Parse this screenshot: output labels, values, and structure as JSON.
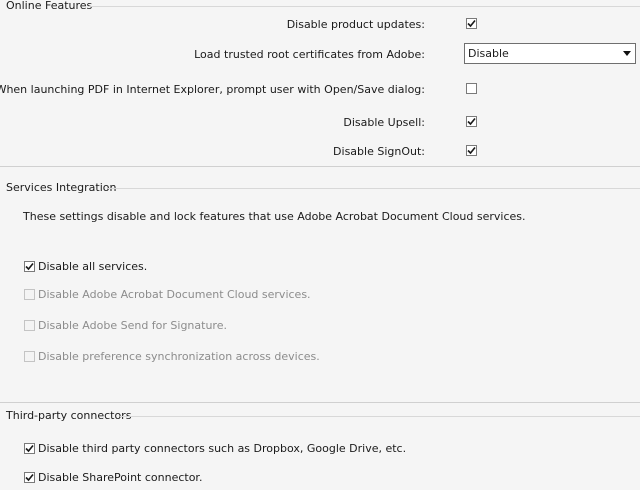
{
  "online_features": {
    "title": "Online Features",
    "disable_updates": {
      "label": "Disable product updates:",
      "checked": true
    },
    "root_certs": {
      "label": "Load trusted root certificates from Adobe:",
      "value": "Disable"
    },
    "ie_prompt": {
      "label": "When launching PDF in Internet Explorer, prompt user with Open/Save dialog:",
      "checked": false
    },
    "disable_upsell": {
      "label": "Disable Upsell:",
      "checked": true
    },
    "disable_signout": {
      "label": "Disable SignOut:",
      "checked": true
    }
  },
  "services_integration": {
    "title": "Services Integration",
    "description": "These settings disable and lock features that use Adobe Acrobat Document Cloud services.",
    "options": [
      {
        "label": "Disable all services.",
        "checked": true,
        "enabled": true
      },
      {
        "label": "Disable Adobe Acrobat Document Cloud services.",
        "checked": false,
        "enabled": false
      },
      {
        "label": "Disable Adobe Send for Signature.",
        "checked": false,
        "enabled": false
      },
      {
        "label": "Disable preference synchronization across devices.",
        "checked": false,
        "enabled": false
      }
    ]
  },
  "third_party": {
    "title": "Third-party connectors",
    "options": [
      {
        "label": "Disable third party connectors such as Dropbox, Google Drive, etc.",
        "checked": true,
        "enabled": true
      },
      {
        "label": "Disable SharePoint connector.",
        "checked": true,
        "enabled": true
      }
    ]
  }
}
